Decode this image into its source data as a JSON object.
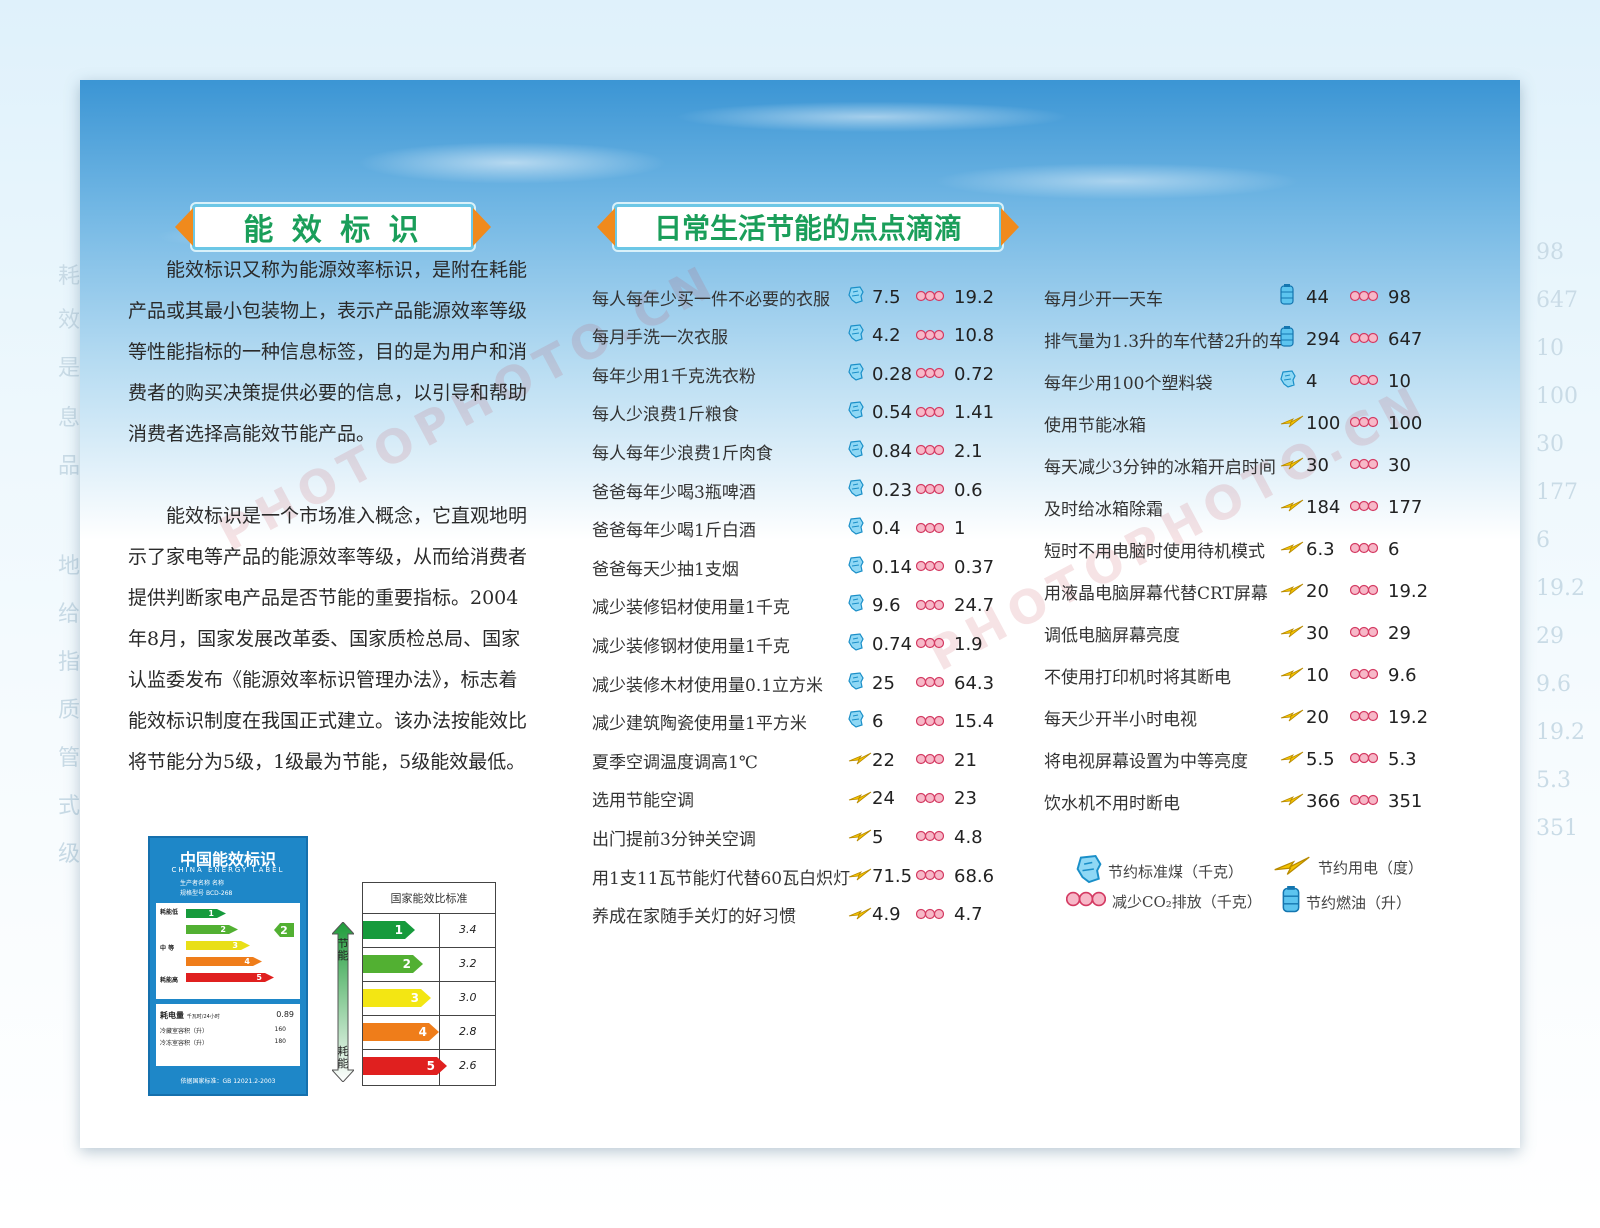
{
  "left_section": {
    "title": "能 效 标 识",
    "paragraph1": "能效标识又称为能源效率标识，是附在耗能产品或其最小包装物上，表示产品能源效率等级等性能指标的一种信息标签，目的是为用户和消费者的购买决策提供必要的信息，以引导和帮助消费者选择高能效节能产品。",
    "paragraph2": "能效标识是一个市场准入概念，它直观地明示了家电等产品的能源效率等级，从而给消费者提供判断家电产品是否节能的重要指标。2004年8月，国家发展改革委、国家质检总局、国家认监委发布《能源效率标识管理办法》，标志着能效标识制度在我国正式建立。该办法按能效比将节能分为5级，1级最为节能，5级能效最低。"
  },
  "energy_label": {
    "title": "中国能效标识",
    "subtitle": "CHINA ENERGY LABEL",
    "maker_label": "生产者名称",
    "maker_value": "名称",
    "model_label": "规格型号",
    "model_value": "BCD-268",
    "low_label": "耗能低",
    "mid_label": "中 等",
    "high_label": "耗能高",
    "grade": "2",
    "bars": [
      "1",
      "2",
      "3",
      "4",
      "5"
    ],
    "consumption_label": "耗电量",
    "consumption_unit": "千瓦时/24小时",
    "consumption_value": "0.89",
    "fridge_label": "冷藏室容积（升）",
    "fridge_value": "160",
    "freezer_label": "冷冻室容积（升）",
    "freezer_value": "180",
    "standard": "依据国家标准：GB 12021.2-2003"
  },
  "scale_chart": {
    "header": "国家能效比标准",
    "arrow_top": "节能",
    "arrow_bottom": "耗能",
    "rows": [
      {
        "grade": "1",
        "value": "3.4",
        "color": "#169a3c"
      },
      {
        "grade": "2",
        "value": "3.2",
        "color": "#52b032"
      },
      {
        "grade": "3",
        "value": "3.0",
        "color": "#f3e613"
      },
      {
        "grade": "4",
        "value": "2.8",
        "color": "#ef7d1a"
      },
      {
        "grade": "5",
        "value": "2.6",
        "color": "#e0201f"
      }
    ]
  },
  "right_section": {
    "title": "日常生活节能的点点滴滴"
  },
  "tips_left": [
    {
      "text": "每人每年少买一件不必要的衣服",
      "icon1": "coal-icon",
      "v1": "7.5",
      "v2": "19.2"
    },
    {
      "text": "每月手洗一次衣服",
      "icon1": "coal-icon",
      "v1": "4.2",
      "v2": "10.8"
    },
    {
      "text": "每年少用1千克洗衣粉",
      "icon1": "coal-icon",
      "v1": "0.28",
      "v2": "0.72"
    },
    {
      "text": "每人少浪费1斤粮食",
      "icon1": "coal-icon",
      "v1": "0.54",
      "v2": "1.41"
    },
    {
      "text": "每人每年少浪费1斤肉食",
      "icon1": "coal-icon",
      "v1": "0.84",
      "v2": "2.1"
    },
    {
      "text": "爸爸每年少喝3瓶啤酒",
      "icon1": "coal-icon",
      "v1": "0.23",
      "v2": "0.6"
    },
    {
      "text": "爸爸每年少喝1斤白酒",
      "icon1": "coal-icon",
      "v1": "0.4",
      "v2": "1"
    },
    {
      "text": "爸爸每天少抽1支烟",
      "icon1": "coal-icon",
      "v1": "0.14",
      "v2": "0.37"
    },
    {
      "text": "减少装修铝材使用量1千克",
      "icon1": "coal-icon",
      "v1": "9.6",
      "v2": "24.7"
    },
    {
      "text": "减少装修钢材使用量1千克",
      "icon1": "coal-icon",
      "v1": "0.74",
      "v2": "1.9"
    },
    {
      "text": "减少装修木材使用量0.1立方米",
      "icon1": "coal-icon",
      "v1": "25",
      "v2": "64.3"
    },
    {
      "text": "减少建筑陶瓷使用量1平方米",
      "icon1": "coal-icon",
      "v1": "6",
      "v2": "15.4"
    },
    {
      "text": "夏季空调温度调高1℃",
      "icon1": "electricity-icon",
      "v1": "22",
      "v2": "21"
    },
    {
      "text": "选用节能空调",
      "icon1": "electricity-icon",
      "v1": "24",
      "v2": "23"
    },
    {
      "text": "出门提前3分钟关空调",
      "icon1": "electricity-icon",
      "v1": "5",
      "v2": "4.8"
    },
    {
      "text": "用1支11瓦节能灯代替60瓦白炽灯",
      "icon1": "electricity-icon",
      "v1": "71.5",
      "v2": "68.6"
    },
    {
      "text": "养成在家随手关灯的好习惯",
      "icon1": "electricity-icon",
      "v1": "4.9",
      "v2": "4.7"
    }
  ],
  "tips_right": [
    {
      "text": "每月少开一天车",
      "icon1": "oil-icon",
      "v1": "44",
      "v2": "98"
    },
    {
      "text": "排气量为1.3升的车代替2升的车",
      "icon1": "oil-icon",
      "v1": "294",
      "v2": "647"
    },
    {
      "text": "每年少用100个塑料袋",
      "icon1": "coal-icon",
      "v1": "4",
      "v2": "10"
    },
    {
      "text": "使用节能冰箱",
      "icon1": "electricity-icon",
      "v1": "100",
      "v2": "100"
    },
    {
      "text": "每天减少3分钟的冰箱开启时间",
      "icon1": "electricity-icon",
      "v1": "30",
      "v2": "30"
    },
    {
      "text": "及时给冰箱除霜",
      "icon1": "electricity-icon",
      "v1": "184",
      "v2": "177"
    },
    {
      "text": "短时不用电脑时使用待机模式",
      "icon1": "electricity-icon",
      "v1": "6.3",
      "v2": "6"
    },
    {
      "text": "用液晶电脑屏幕代替CRT屏幕",
      "icon1": "electricity-icon",
      "v1": "20",
      "v2": "19.2"
    },
    {
      "text": "调低电脑屏幕亮度",
      "icon1": "electricity-icon",
      "v1": "30",
      "v2": "29"
    },
    {
      "text": "不使用打印机时将其断电",
      "icon1": "electricity-icon",
      "v1": "10",
      "v2": "9.6"
    },
    {
      "text": "每天少开半小时电视",
      "icon1": "electricity-icon",
      "v1": "20",
      "v2": "19.2"
    },
    {
      "text": "将电视屏幕设置为中等亮度",
      "icon1": "electricity-icon",
      "v1": "5.5",
      "v2": "5.3"
    },
    {
      "text": "饮水机不用时断电",
      "icon1": "electricity-icon",
      "v1": "366",
      "v2": "351"
    }
  ],
  "legend": {
    "coal": "节约标准煤（千克）",
    "electricity": "节约用电（度）",
    "co2": "减少CO₂排放（千克）",
    "oil": "节约燃油（升）"
  },
  "watermark": "PHOTOPHOTO.CN",
  "colors": {
    "title_green": "#1a9e5a",
    "banner_border": "#6cc7e6",
    "arrow_orange": "#f08a1c",
    "label_blue": "#1e87c8"
  }
}
